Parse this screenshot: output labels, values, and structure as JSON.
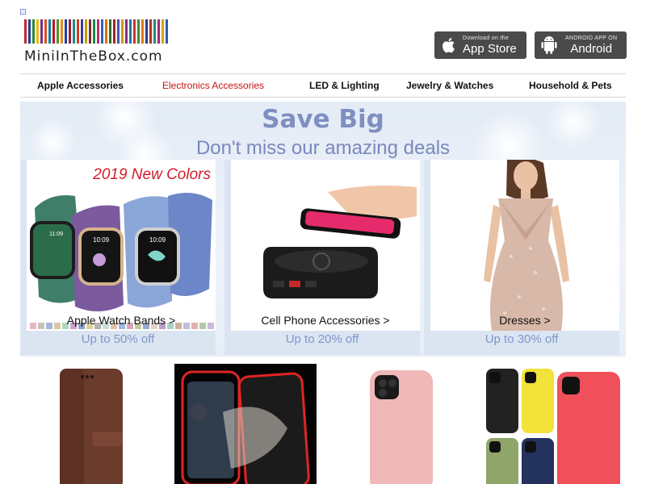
{
  "header": {
    "logo_text": "MiniInTheBox.com",
    "barcode_colors": [
      "#c1272d",
      "#1f3f8f",
      "#2a8a3e",
      "#f2b705",
      "#7a2e8e",
      "#d4541a",
      "#0d7fa6",
      "#b8192a",
      "#5a8f29",
      "#e0901d",
      "#233f9a",
      "#9a1b3b",
      "#1a8a7a",
      "#d63b21",
      "#3c3c9a",
      "#c99a06",
      "#7d2d2d",
      "#168c4d",
      "#be2f6d",
      "#365fbf",
      "#e26b0a",
      "#2e6e2e",
      "#a12727",
      "#4f4faf",
      "#c4a010",
      "#8a2b85",
      "#1e7a9f",
      "#cc3333",
      "#3d8b3d",
      "#e07a10",
      "#2b3d8f",
      "#b03030",
      "#2a8a6a",
      "#9c2a7a",
      "#d6a21b",
      "#2f5aa8"
    ],
    "app_store": {
      "small": "Download on the",
      "big": "App Store",
      "icon": "apple-logo-icon"
    },
    "android": {
      "small": "ANDROID APP ON",
      "big": "Android",
      "icon": "android-logo-icon"
    }
  },
  "nav": {
    "items": [
      {
        "label": "Apple Accessories",
        "active": false
      },
      {
        "label": "Electronics Accessories",
        "active": true
      },
      {
        "label": "LED & Lighting",
        "active": false
      },
      {
        "label": "Jewelry & Watches",
        "active": false
      },
      {
        "label": "Household & Pets",
        "active": false
      }
    ],
    "active_color": "#c31414"
  },
  "banner": {
    "title": "Save Big",
    "subtitle": "Don't miss our amazing deals",
    "cards": [
      {
        "label": "Apple Watch Bands >",
        "promo": "Up to 50% off",
        "badge": "2019 New Colors"
      },
      {
        "label": "Cell Phone Accessories >",
        "promo": "Up to 20% off"
      },
      {
        "label": "Dresses >",
        "promo": "Up to 30% off"
      }
    ]
  }
}
